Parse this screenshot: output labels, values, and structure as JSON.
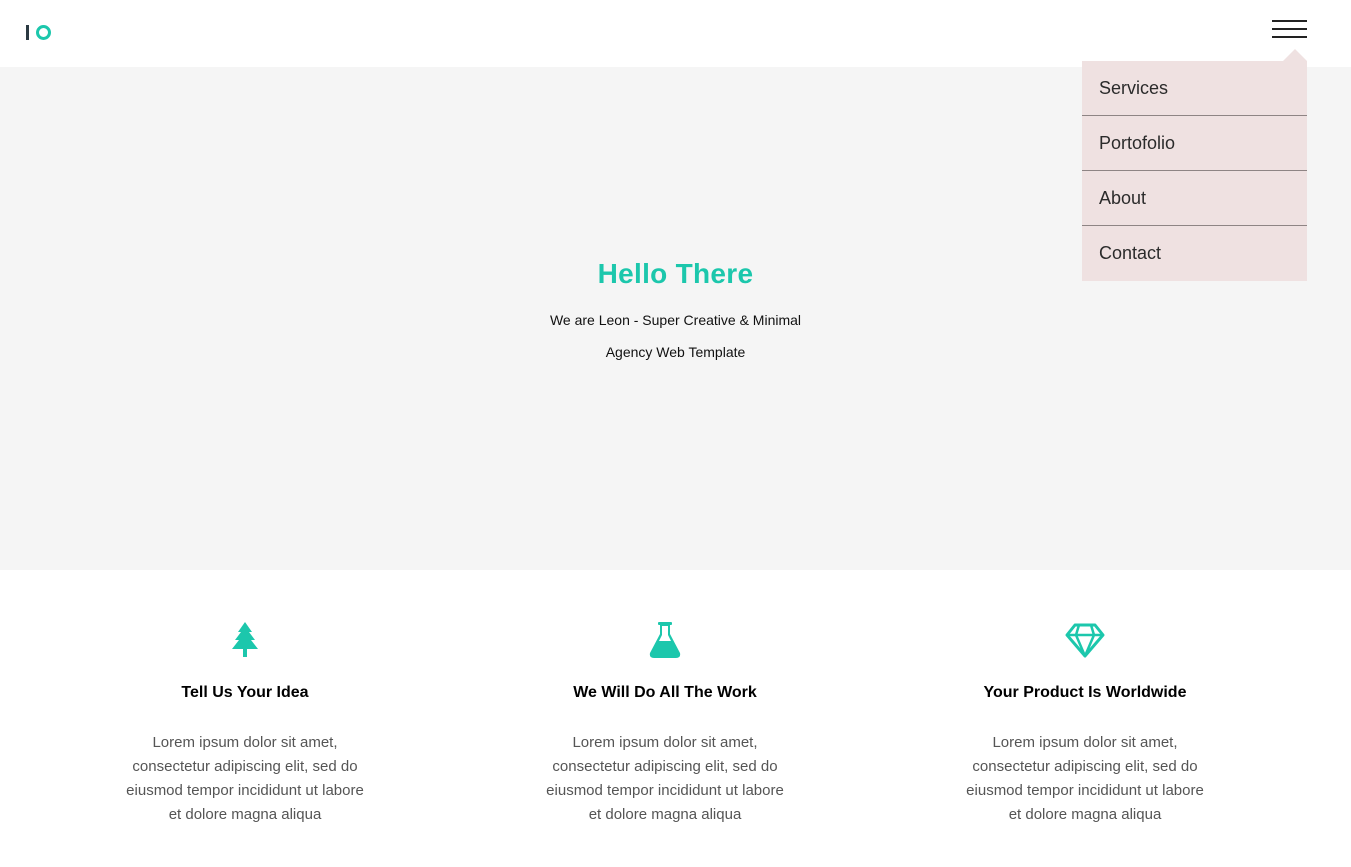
{
  "header": {
    "logo_icon": "io-logo-icon",
    "menu_icon": "hamburger-icon"
  },
  "menu": {
    "items": [
      {
        "label": "Services"
      },
      {
        "label": "Portofolio"
      },
      {
        "label": "About"
      },
      {
        "label": "Contact"
      }
    ]
  },
  "hero": {
    "title": "Hello There",
    "subtitle_line1": "We are Leon - Super Creative & Minimal",
    "subtitle_line2": "Agency Web Template"
  },
  "features": [
    {
      "icon": "tree-icon",
      "title": "Tell Us Your Idea",
      "text": "Lorem ipsum dolor sit amet, consectetur adipiscing elit, sed do eiusmod tempor incididunt ut labore et dolore magna aliqua"
    },
    {
      "icon": "flask-icon",
      "title": "We Will Do All The Work",
      "text": "Lorem ipsum dolor sit amet, consectetur adipiscing elit, sed do eiusmod tempor incididunt ut labore et dolore magna aliqua"
    },
    {
      "icon": "diamond-icon",
      "title": "Your Product Is Worldwide",
      "text": "Lorem ipsum dolor sit amet, consectetur adipiscing elit, sed do eiusmod tempor incididunt ut labore et dolore magna aliqua"
    }
  ],
  "colors": {
    "accent": "#1cc7ac",
    "hero_bg": "#f5f5f5",
    "menu_bg": "#efe1e1"
  }
}
